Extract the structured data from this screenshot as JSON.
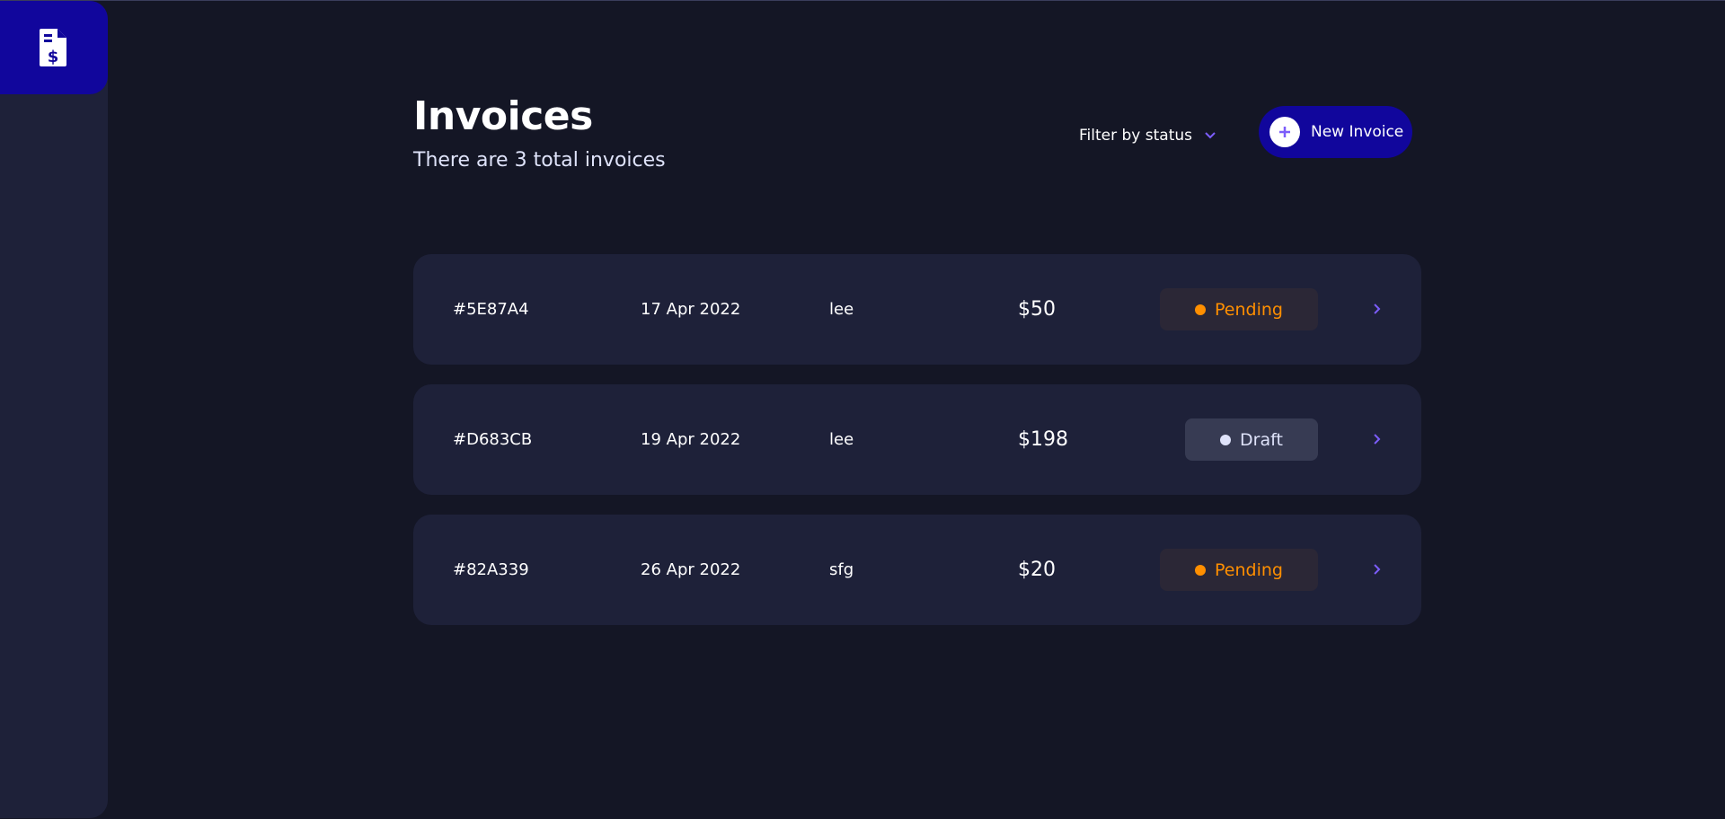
{
  "header": {
    "title": "Invoices",
    "subtitle": "There are 3 total invoices",
    "filter_label": "Filter by status",
    "new_invoice_label": "New Invoice"
  },
  "invoices": [
    {
      "id": "#5E87A4",
      "date": "17 Apr 2022",
      "client": "lee",
      "amount": "$50",
      "status": "Pending"
    },
    {
      "id": "#D683CB",
      "date": "19 Apr 2022",
      "client": "lee",
      "amount": "$198",
      "status": "Draft"
    },
    {
      "id": "#82A339",
      "date": "26 Apr 2022",
      "client": "sfg",
      "amount": "$20",
      "status": "Pending"
    }
  ],
  "colors": {
    "background": "#141625",
    "surface": "#1e2139",
    "accent": "#11069c",
    "accent_light": "#7c5dfa",
    "pending": "#ff8f00",
    "draft": "#dfe3fa"
  },
  "icons": {
    "logo": "invoice-dollar-icon",
    "filter": "chevron-down-icon",
    "new": "plus-icon",
    "row": "chevron-right-icon"
  }
}
